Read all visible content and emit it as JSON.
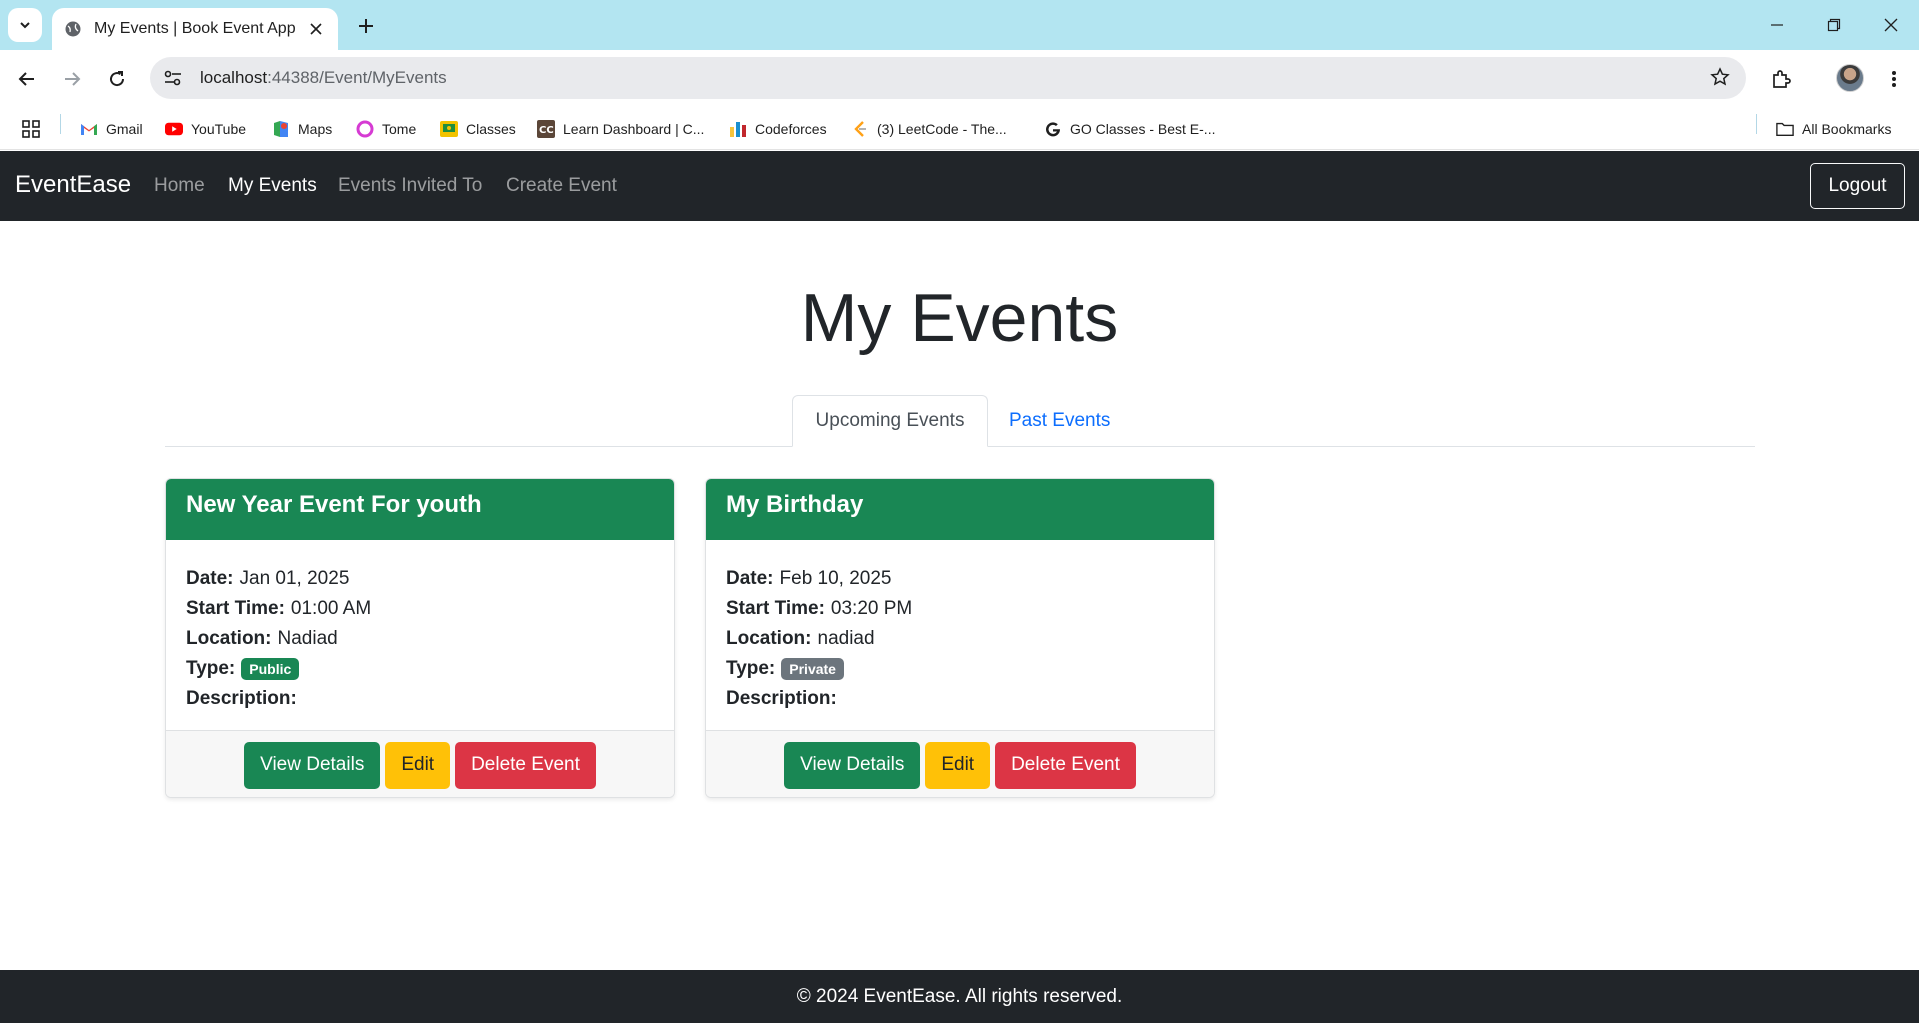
{
  "browser": {
    "tab_title": "My Events | Book Event App",
    "url_host": "localhost",
    "url_rest": ":44388/Event/MyEvents",
    "bookmarks": [
      {
        "label": "Gmail",
        "icon": "gmail-icon"
      },
      {
        "label": "YouTube",
        "icon": "youtube-icon"
      },
      {
        "label": "Maps",
        "icon": "maps-icon"
      },
      {
        "label": "Tome",
        "icon": "tome-icon"
      },
      {
        "label": "Classes",
        "icon": "classes-icon"
      },
      {
        "label": "Learn Dashboard | C...",
        "icon": "codechef-icon"
      },
      {
        "label": "Codeforces",
        "icon": "codeforces-icon"
      },
      {
        "label": "(3) LeetCode - The...",
        "icon": "leetcode-icon"
      },
      {
        "label": "GO Classes - Best E-...",
        "icon": "google-icon"
      }
    ],
    "all_bookmarks": "All Bookmarks"
  },
  "navbar": {
    "brand": "EventEase",
    "links": [
      "Home",
      "My Events",
      "Events Invited To",
      "Create Event"
    ],
    "active": "My Events",
    "logout": "Logout"
  },
  "page": {
    "title": "My Events",
    "tabs": [
      "Upcoming Events",
      "Past Events"
    ]
  },
  "labels": {
    "date": "Date:",
    "start_time": "Start Time:",
    "location": "Location:",
    "type": "Type:",
    "description": "Description:",
    "view_details": "View Details",
    "edit": "Edit",
    "delete": "Delete Event"
  },
  "events": [
    {
      "title": "New Year Event For youth",
      "date": "Jan 01, 2025",
      "start_time": "01:00 AM",
      "location": "Nadiad",
      "type": "Public",
      "description": ""
    },
    {
      "title": "My Birthday",
      "date": "Feb 10, 2025",
      "start_time": "03:20 PM",
      "location": "nadiad",
      "type": "Private",
      "description": ""
    }
  ],
  "footer": "© 2024 EventEase. All rights reserved.",
  "colors": {
    "navbar_bg": "#212529",
    "card_header": "#198754",
    "badge_public": "#198754",
    "badge_private": "#6c757d",
    "btn_success": "#198754",
    "btn_warning": "#ffc107",
    "btn_danger": "#dc3545",
    "link": "#0d6efd",
    "tabstrip": "#b3e5f1"
  }
}
